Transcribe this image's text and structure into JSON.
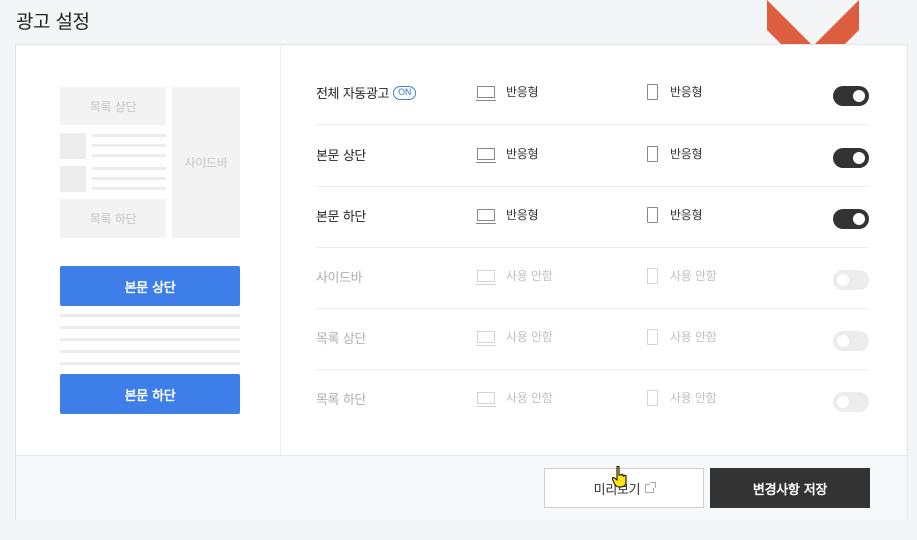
{
  "page": {
    "title": "광고 설정"
  },
  "colors": {
    "accent_blue": "#3d7ee8",
    "toggle_on": "#333333",
    "marker": "#dd5d3f"
  },
  "preview": {
    "list_top": "목록 상단",
    "list_bottom": "목록 하단",
    "sidebar": "사이드바",
    "body_top": "본문 상단",
    "body_bottom": "본문 하단"
  },
  "settings": {
    "rows": [
      {
        "label": "전체 자동광고",
        "badge": "ON",
        "pc": "반응형",
        "mobile": "반응형",
        "enabled": true
      },
      {
        "label": "본문 상단",
        "pc": "반응형",
        "mobile": "반응형",
        "enabled": true
      },
      {
        "label": "본문 하단",
        "pc": "반응형",
        "mobile": "반응형",
        "enabled": true
      },
      {
        "label": "사이드바",
        "pc": "사용 안함",
        "mobile": "사용 안함",
        "enabled": false
      },
      {
        "label": "목록 상단",
        "pc": "사용 안함",
        "mobile": "사용 안함",
        "enabled": false
      },
      {
        "label": "목록 하단",
        "pc": "사용 안함",
        "mobile": "사용 안함",
        "enabled": false
      }
    ]
  },
  "footer": {
    "preview_label": "미리보기",
    "save_label": "변경사항 저장"
  },
  "icons": [
    "pc-icon",
    "mobile-icon",
    "external-link-icon",
    "pointer-cursor-icon",
    "chevron-down-icon"
  ]
}
